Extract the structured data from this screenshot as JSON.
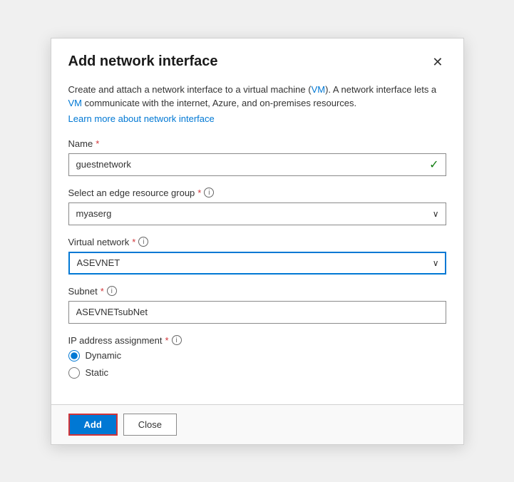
{
  "dialog": {
    "title": "Add network interface",
    "close_label": "×",
    "description_part1": "Create and attach a network interface to a virtual machine (VM). A network interface lets a VM communicate with the internet, Azure, and on-premises resources.",
    "learn_more_text": "Learn more about network interface",
    "vm_text": "VM",
    "vm_text2": "VM"
  },
  "form": {
    "name_label": "Name",
    "name_placeholder": "",
    "name_value": "guestnetwork",
    "edge_resource_group_label": "Select an edge resource group",
    "edge_resource_group_value": "myaserg",
    "virtual_network_label": "Virtual network",
    "virtual_network_value": "ASEVNET",
    "subnet_label": "Subnet",
    "subnet_value": "ASEVNETsubNet",
    "ip_assignment_label": "IP address assignment",
    "ip_options": [
      {
        "value": "dynamic",
        "label": "Dynamic",
        "checked": true
      },
      {
        "value": "static",
        "label": "Static",
        "checked": false
      }
    ]
  },
  "footer": {
    "add_label": "Add",
    "close_label": "Close"
  },
  "icons": {
    "checkmark": "✓",
    "chevron_down": "⌄",
    "info": "i",
    "close": "✕"
  }
}
